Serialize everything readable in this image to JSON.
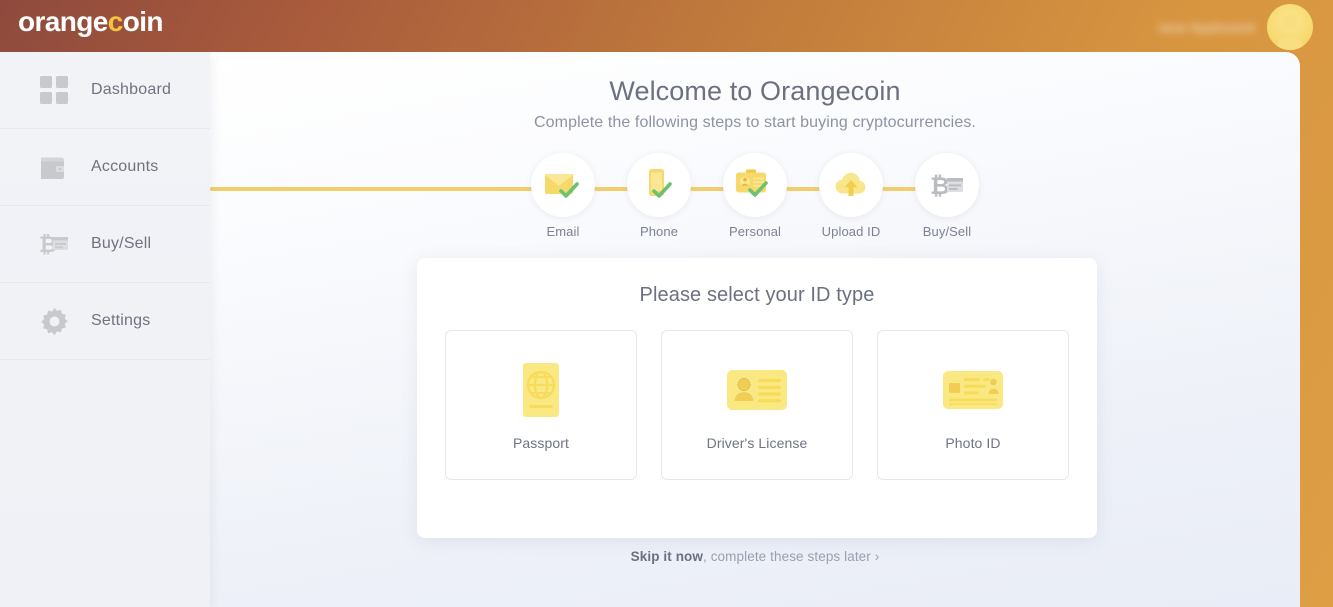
{
  "brand": {
    "logo_main": "orange",
    "logo_accent": "c",
    "logo_tail": "oin",
    "accent_color": "#f5c23f",
    "header_gradient_from": "#8e4a3d",
    "header_gradient_to": "#dd9e44"
  },
  "topbar": {
    "user_name": "Jane Appleseed",
    "avatar_icon": "user-avatar-icon"
  },
  "sidebar": {
    "items": [
      {
        "label": "Dashboard",
        "icon": "grid-icon"
      },
      {
        "label": "Accounts",
        "icon": "wallet-icon"
      },
      {
        "label": "Buy/Sell",
        "icon": "bitcoin-card-icon"
      },
      {
        "label": "Settings",
        "icon": "gear-icon"
      }
    ]
  },
  "main": {
    "title": "Welcome to Orangecoin",
    "subtitle": "Complete the following steps to start buying cryptocurrencies.",
    "steps": [
      {
        "label": "Email",
        "icon": "envelope-icon",
        "state": "complete"
      },
      {
        "label": "Phone",
        "icon": "phone-icon",
        "state": "complete"
      },
      {
        "label": "Personal",
        "icon": "id-badge-icon",
        "state": "complete"
      },
      {
        "label": "Upload ID",
        "icon": "cloud-upload-icon",
        "state": "active"
      },
      {
        "label": "Buy/Sell",
        "icon": "bitcoin-card-icon",
        "state": "pending"
      }
    ],
    "card": {
      "title": "Please select your ID type",
      "options": [
        {
          "label": "Passport",
          "icon": "passport-book-icon"
        },
        {
          "label": "Driver's License",
          "icon": "id-card-person-icon"
        },
        {
          "label": "Photo ID",
          "icon": "photo-id-card-icon"
        }
      ]
    },
    "skip": {
      "strong": "Skip it now",
      "rest": ", complete these steps later",
      "chevron": "›"
    }
  }
}
